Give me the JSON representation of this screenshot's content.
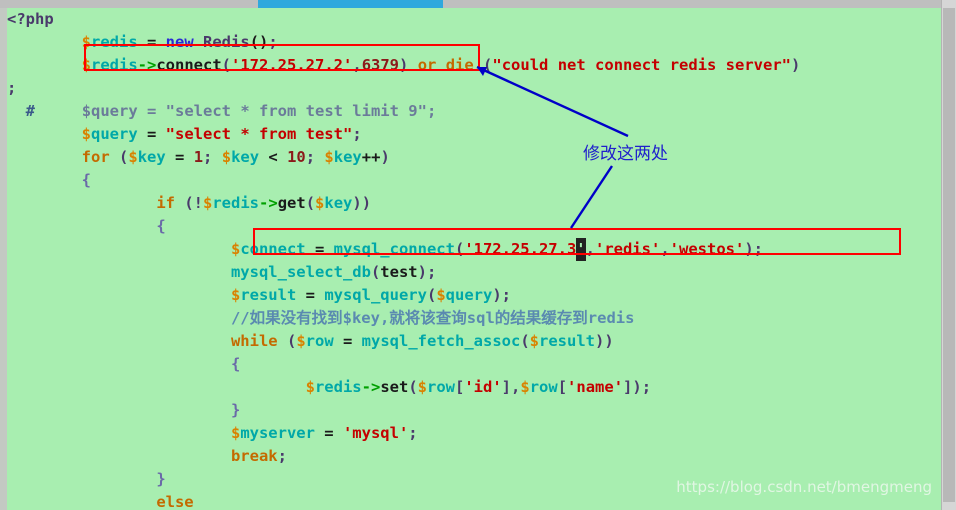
{
  "window": {
    "background_color": "#a8eeb0",
    "scrollbar": {
      "horizontal_thumb_color": "#2fa8dd",
      "vertical_thumb_color": "#b8b8b8"
    }
  },
  "editor": {
    "language": "php",
    "lines": [
      {
        "indent": 0,
        "text": "<?php"
      },
      {
        "indent": 0,
        "text": "        $redis = new Redis();"
      },
      {
        "indent": 0,
        "text": "        $redis->connect('172.25.27.2',6379) or die (\"could net connect redis server\")"
      },
      {
        "indent": 0,
        "text": ";"
      },
      {
        "indent": 0,
        "text": "  #     $query = \"select * from test limit 9\";"
      },
      {
        "indent": 0,
        "text": "        $query = \"select * from test\";"
      },
      {
        "indent": 0,
        "text": "        for ($key = 1; $key < 10; $key++)"
      },
      {
        "indent": 0,
        "text": "        {"
      },
      {
        "indent": 0,
        "text": "                if (!$redis->get($key))"
      },
      {
        "indent": 0,
        "text": "                {"
      },
      {
        "indent": 0,
        "text": "                        $connect = mysql_connect('172.25.27.3','redis','westos');"
      },
      {
        "indent": 0,
        "text": "                        mysql_select_db(test);"
      },
      {
        "indent": 0,
        "text": "                        $result = mysql_query($query);"
      },
      {
        "indent": 0,
        "text": "                        //如果没有找到$key,就将该查询sql的结果缓存到redis"
      },
      {
        "indent": 0,
        "text": "                        while ($row = mysql_fetch_assoc($result))"
      },
      {
        "indent": 0,
        "text": "                        {"
      },
      {
        "indent": 0,
        "text": "                                $redis->set($row['id'],$row['name']);"
      },
      {
        "indent": 0,
        "text": "                        }"
      },
      {
        "indent": 0,
        "text": "                        $myserver = 'mysql';"
      },
      {
        "indent": 0,
        "text": "                        break;"
      },
      {
        "indent": 0,
        "text": "                }"
      },
      {
        "indent": 0,
        "text": "                else"
      }
    ],
    "cursor": {
      "on_line": 10,
      "character": "'",
      "description": "block cursor over closing quote of 172.25.27.3"
    }
  },
  "annotations": {
    "highlight_boxes": [
      {
        "label": "redis-connect-line-highlight",
        "color": "#ff0000"
      },
      {
        "label": "mysql-connect-line-highlight",
        "color": "#ff0000"
      }
    ],
    "note": {
      "text": "修改这两处",
      "color": "#2020cc"
    },
    "arrows": [
      {
        "label": "arrow-to-redis-connect",
        "color": "#0000c8"
      },
      {
        "label": "arrow-to-mysql-connect",
        "color": "#0000c8"
      }
    ]
  },
  "watermark": {
    "text": "https://blog.csdn.net/bmengmeng"
  }
}
